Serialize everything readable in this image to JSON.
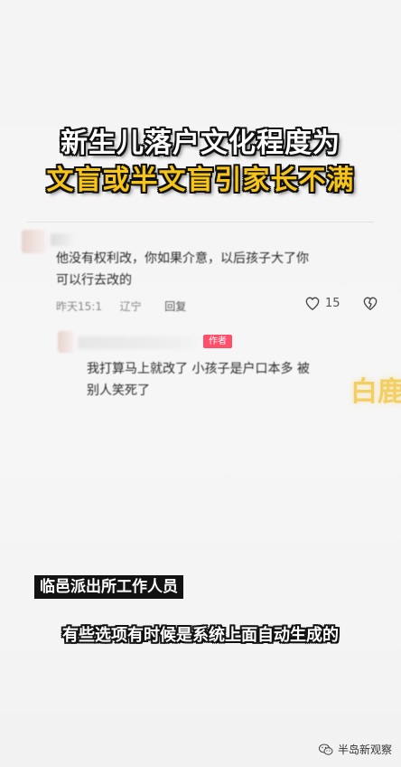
{
  "headline": {
    "line1": "新生儿落户文化程度为",
    "line2": "文盲或半文盲引家长不满"
  },
  "comment": {
    "text_line1": "他没有权利改，你如果介意，以后孩子大了你",
    "text_line2": "可以行去改的",
    "time": "昨天15:1",
    "location": "辽宁",
    "reply_label": "回复",
    "like_count": "15"
  },
  "reply": {
    "author_badge": "作者",
    "text_line1": "我打算马上就改了 小孩子是户口本多 被",
    "text_line2": "别人笑死了"
  },
  "watermark": "白鹿",
  "caption": {
    "speaker_label": "临邑派出所工作人员",
    "subtitle": "有些选项有时候是系统上面自动生成的"
  },
  "source": {
    "name": "半岛新观察",
    "icon": "wechat-icon"
  }
}
